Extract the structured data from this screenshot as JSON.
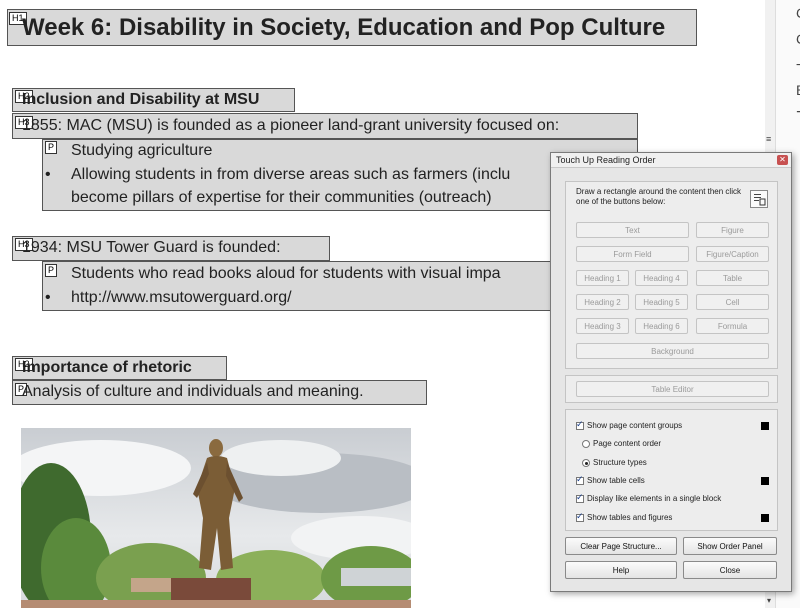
{
  "document": {
    "h1": {
      "tag": "H1",
      "text": "Week 6: Disability in Society, Education and Pop Culture"
    },
    "section1": {
      "heading_tag": "H2",
      "heading": "Inclusion and Disability at MSU",
      "sub1_tag": "H3",
      "sub1": "1855: MAC (MSU) is founded as a pioneer land-grant university focused on:",
      "p_tag": "P",
      "item1": "Studying agriculture",
      "item2_line1": "Allowing students in from diverse areas such as farmers (inclu",
      "item2_line2": "become pillars of expertise for their communities (outreach)",
      "sub2_tag": "H3",
      "sub2": "1934: MSU Tower Guard is founded:",
      "item3": "Students who read books aloud for students with visual impa",
      "item4": "http://www.msutowerguard.org/"
    },
    "section2": {
      "heading_tag": "H2",
      "heading": "Importance of rhetoric",
      "p_tag": "P",
      "paragraph": "Analysis of culture and individuals and meaning."
    }
  },
  "right_strip": {
    "glyphs": [
      "C",
      "C",
      "⊸",
      "B",
      "⊹",
      "≡"
    ]
  },
  "dialog": {
    "title": "Touch Up Reading Order",
    "instruction": "Draw a rectangle around the content then click one of the buttons below:",
    "buttons": {
      "text": "Text",
      "figure": "Figure",
      "form_field": "Form Field",
      "figure_caption": "Figure/Caption",
      "heading1": "Heading 1",
      "heading4": "Heading 4",
      "table": "Table",
      "heading2": "Heading 2",
      "heading5": "Heading 5",
      "cell": "Cell",
      "heading3": "Heading 3",
      "heading6": "Heading 6",
      "formula": "Formula",
      "background": "Background",
      "table_editor": "Table Editor",
      "clear_page_structure": "Clear Page Structure...",
      "show_order_panel": "Show Order Panel",
      "help": "Help",
      "close": "Close"
    },
    "options": {
      "show_page_content_groups": "Show page content groups",
      "page_content_order": "Page content order",
      "structure_types": "Structure types",
      "show_table_cells": "Show table cells",
      "display_like_elements": "Display like elements in a single block",
      "show_tables_and_figures": "Show tables and figures"
    },
    "state": {
      "show_page_content_groups": true,
      "grouping": "structure_types",
      "show_table_cells": true,
      "display_like_elements": true,
      "show_tables_and_figures": true
    },
    "colors": {
      "swatch": "#000000",
      "close_button": "#c75050"
    }
  }
}
